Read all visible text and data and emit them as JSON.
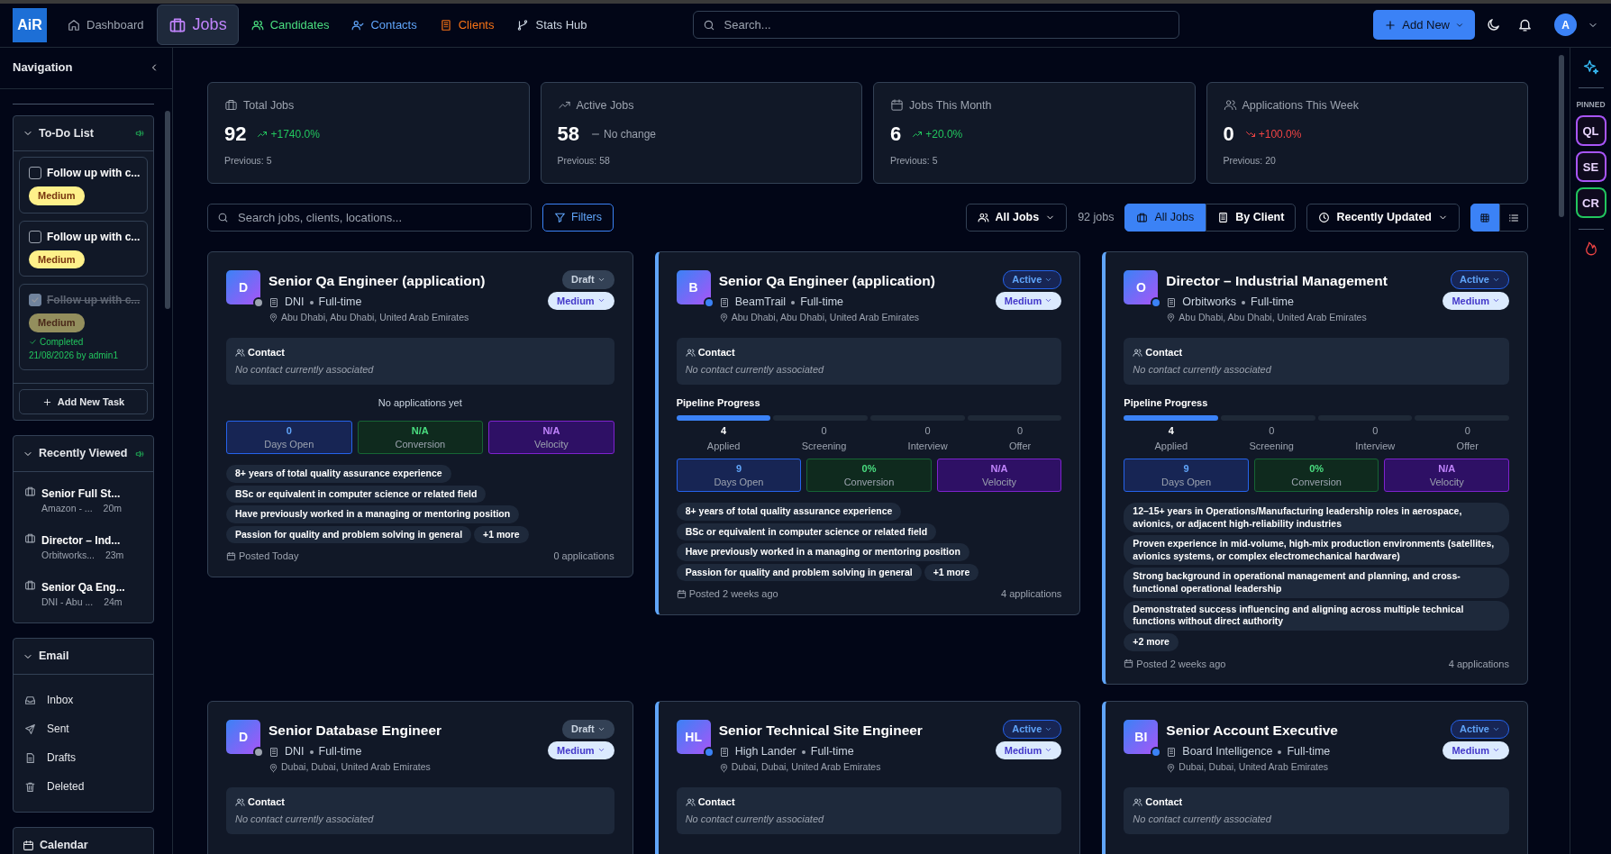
{
  "topbar": {
    "logo": "AiR",
    "nav": [
      {
        "label": "Dashboard",
        "selected": false
      },
      {
        "label": "Jobs",
        "selected": true
      },
      {
        "label": "Candidates",
        "selected": false
      },
      {
        "label": "Contacts",
        "selected": false
      },
      {
        "label": "Clients",
        "selected": false
      },
      {
        "label": "Stats Hub",
        "selected": false
      }
    ],
    "search": {
      "placeholder": "Search..."
    },
    "add_new": "Add New",
    "avatar": "A"
  },
  "sidebar": {
    "title": "Navigation",
    "todo": {
      "title": "To-Do List",
      "tasks": [
        {
          "text": "Follow up with c...",
          "priority": "Medium",
          "checked": false
        },
        {
          "text": "Follow up with c...",
          "priority": "Medium",
          "checked": false
        },
        {
          "text": "Follow up with c...",
          "priority": "Medium",
          "checked": true,
          "status": "Completed",
          "completed_by": "21/08/2026 by admin1"
        }
      ],
      "add_task": "Add New Task"
    },
    "recently_viewed": {
      "title": "Recently Viewed",
      "items": [
        {
          "title": "Senior Full St...",
          "subtitle": "Amazon - ...",
          "time": "20m"
        },
        {
          "title": "Director – Ind...",
          "subtitle": "Orbitworks...",
          "time": "23m"
        },
        {
          "title": "Senior Qa Eng...",
          "subtitle": "DNI - Abu ...",
          "time": "24m"
        }
      ]
    },
    "email": {
      "title": "Email",
      "items": [
        {
          "label": "Inbox"
        },
        {
          "label": "Sent"
        },
        {
          "label": "Drafts"
        },
        {
          "label": "Deleted"
        }
      ]
    },
    "calendar": {
      "title": "Calendar"
    }
  },
  "stats": [
    {
      "label": "Total Jobs",
      "value": "92",
      "change": "+1740.0%",
      "kind": "up",
      "previous": "Previous: 5"
    },
    {
      "label": "Active Jobs",
      "value": "58",
      "change": "No change",
      "kind": "flat",
      "previous": "Previous: 58"
    },
    {
      "label": "Jobs This Month",
      "value": "6",
      "change": "+20.0%",
      "kind": "up",
      "previous": "Previous: 5"
    },
    {
      "label": "Applications This Week",
      "value": "0",
      "change": "+100.0%",
      "kind": "down",
      "previous": "Previous: 20"
    }
  ],
  "toolbar": {
    "search": {
      "placeholder": "Search jobs, clients, locations..."
    },
    "filters": "Filters",
    "owner_filter": "All Jobs",
    "count": "92 jobs",
    "grouping": [
      {
        "label": "All Jobs",
        "selected": true
      },
      {
        "label": "By Client",
        "selected": false
      }
    ],
    "sort": "Recently Updated",
    "layouts": [
      {
        "kind": "grid",
        "selected": true
      },
      {
        "kind": "list",
        "selected": false
      }
    ]
  },
  "jobs": [
    {
      "avatar": "D",
      "title": "Senior Qa Engineer (application)",
      "company": "DNI",
      "type": "Full-time",
      "location": "Abu Dhabi, Abu Dhabi, United Arab Emirates",
      "status": "Draft",
      "priority": "Medium",
      "contact_title": "Contact",
      "contact_text": "No contact currently associated",
      "empty_text": "No applications yet",
      "metrics": [
        {
          "kind": "days",
          "value": "0",
          "label": "Days Open"
        },
        {
          "kind": "conversion",
          "value": "N/A",
          "label": "Conversion"
        },
        {
          "kind": "velocity",
          "value": "N/A",
          "label": "Velocity"
        }
      ],
      "requirements": [
        "8+ years of total quality assurance experience",
        "BSc or equivalent in computer science or related field",
        "Have previously worked in a managing or mentoring position",
        "Passion for quality and problem solving in general"
      ],
      "more": "+1 more",
      "posted": "Posted Today",
      "applications": "0 applications"
    },
    {
      "avatar": "B",
      "title": "Senior Qa Engineer (application)",
      "company": "BeamTrail",
      "type": "Full-time",
      "location": "Abu Dhabi, Abu Dhabi, United Arab Emirates",
      "status": "Active",
      "priority": "Medium",
      "contact_title": "Contact",
      "contact_text": "No contact currently associated",
      "pipeline": {
        "title": "Pipeline Progress",
        "stages": [
          {
            "count": "4",
            "label": "Applied",
            "reached": true
          },
          {
            "count": "0",
            "label": "Screening",
            "reached": false
          },
          {
            "count": "0",
            "label": "Interview",
            "reached": false
          },
          {
            "count": "0",
            "label": "Offer",
            "reached": false
          }
        ]
      },
      "metrics": [
        {
          "kind": "days",
          "value": "9",
          "label": "Days Open"
        },
        {
          "kind": "conversion",
          "value": "0%",
          "label": "Conversion"
        },
        {
          "kind": "velocity",
          "value": "N/A",
          "label": "Velocity"
        }
      ],
      "requirements": [
        "8+ years of total quality assurance experience",
        "BSc or equivalent in computer science or related field",
        "Have previously worked in a managing or mentoring position",
        "Passion for quality and problem solving in general"
      ],
      "more": "+1 more",
      "posted": "Posted 2 weeks ago",
      "applications": "4 applications"
    },
    {
      "avatar": "O",
      "title": "Director – Industrial Management",
      "company": "Orbitworks",
      "type": "Full-time",
      "location": "Abu Dhabi, Abu Dhabi, United Arab Emirates",
      "status": "Active",
      "priority": "Medium",
      "contact_title": "Contact",
      "contact_text": "No contact currently associated",
      "pipeline": {
        "title": "Pipeline Progress",
        "stages": [
          {
            "count": "4",
            "label": "Applied",
            "reached": true
          },
          {
            "count": "0",
            "label": "Screening",
            "reached": false
          },
          {
            "count": "0",
            "label": "Interview",
            "reached": false
          },
          {
            "count": "0",
            "label": "Offer",
            "reached": false
          }
        ]
      },
      "metrics": [
        {
          "kind": "days",
          "value": "9",
          "label": "Days Open"
        },
        {
          "kind": "conversion",
          "value": "0%",
          "label": "Conversion"
        },
        {
          "kind": "velocity",
          "value": "N/A",
          "label": "Velocity"
        }
      ],
      "requirements": [
        "12–15+ years in Operations/Manufacturing leadership roles in aerospace, avionics, or adjacent high-reliability industries",
        "Proven experience in mid-volume, high-mix production environments (satellites, avionics systems, or complex electromechanical hardware)",
        "Strong background in operational management and planning, and cross-functional operational leadership",
        "Demonstrated success influencing and aligning across multiple technical functions without direct authority"
      ],
      "more": "+2 more",
      "posted": "Posted 2 weeks ago",
      "applications": "4 applications"
    },
    {
      "avatar": "D",
      "title": "Senior Database Engineer",
      "company": "DNI",
      "type": "Full-time",
      "location": "Dubai, Dubai, United Arab Emirates",
      "status": "Draft",
      "priority": "Medium",
      "contact_title": "Contact",
      "contact_text": "No contact currently associated"
    },
    {
      "avatar": "HL",
      "title": "Senior Technical Site Engineer",
      "company": "High Lander",
      "type": "Full-time",
      "location": "Dubai, Dubai, United Arab Emirates",
      "status": "Active",
      "priority": "Medium",
      "contact_title": "Contact",
      "contact_text": "No contact currently associated"
    },
    {
      "avatar": "BI",
      "title": "Senior Account Executive",
      "company": "Board Intelligence",
      "type": "Full-time",
      "location": "Dubai, Dubai, United Arab Emirates",
      "status": "Active",
      "priority": "Medium",
      "contact_title": "Contact",
      "contact_text": "No contact currently associated"
    }
  ],
  "right_rail": {
    "pinned_title": "PINNED",
    "pinned": [
      {
        "initials": "QL",
        "color": "#a855f7"
      },
      {
        "initials": "SE",
        "color": "#a855f7"
      },
      {
        "initials": "CR",
        "color": "#22c55e"
      }
    ]
  }
}
